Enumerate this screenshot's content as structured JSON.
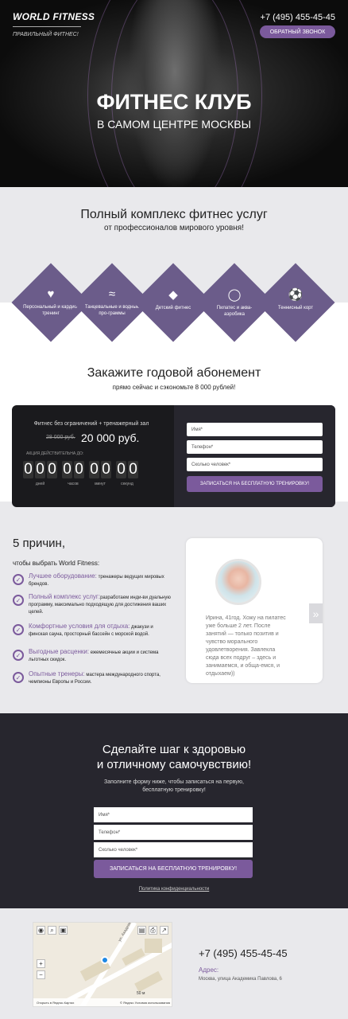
{
  "header": {
    "logo": "WORLD FITNESS",
    "tagline": "ПРАВИЛЬНЫЙ ФИТНЕС!",
    "phone": "+7 (495) 455-45-45",
    "callback_button": "ОБРАТНЫЙ ЗВОНОК",
    "hero_title": "ФИТНЕС КЛУБ",
    "hero_subtitle": "В САМОМ ЦЕНТРЕ МОСКВЫ"
  },
  "services": {
    "title": "Полный комплекс фитнес услуг",
    "subtitle": "от профессионалов мирового уровня!",
    "items": [
      {
        "label": "Персональный и кардио-тренинг",
        "icon": "heart-pulse-icon"
      },
      {
        "label": "Танцевальные и водные про-граммы",
        "icon": "swimmer-icon"
      },
      {
        "label": "Детский фитнес",
        "icon": "kids-icon"
      },
      {
        "label": "Пилатес и аква-аэробика",
        "icon": "pilates-icon"
      },
      {
        "label": "Теннисный корт",
        "icon": "tennis-ball-icon"
      }
    ]
  },
  "offer": {
    "title": "Закажите годовой абонемент",
    "subtitle": "прямо сейчас и сэкономьте 8 000 рублей!",
    "description": "Фитнес без ограничений + тренажерный зал",
    "old_price": "28 000 руб.",
    "new_price": "20 000 руб.",
    "timer_label": "АКЦИЯ ДЕЙСТВИТЕЛЬНА ДО:",
    "timer": [
      {
        "digits": [
          "0",
          "0",
          "0"
        ],
        "unit": "дней"
      },
      {
        "digits": [
          "0",
          "0"
        ],
        "unit": "часов"
      },
      {
        "digits": [
          "0",
          "0"
        ],
        "unit": "минут"
      },
      {
        "digits": [
          "0",
          "0"
        ],
        "unit": "секунд"
      }
    ],
    "form": {
      "name_placeholder": "Имя*",
      "phone_placeholder": "Телефон*",
      "people_placeholder": "Сколько человек*",
      "submit": "ЗАПИСАТЬСЯ НА БЕСПЛАТНУЮ ТРЕНИРОВКУ!"
    }
  },
  "reasons": {
    "title": "5 причин,",
    "subtitle": "чтобы выбрать World Fitness:",
    "items": [
      {
        "head": "Лучшее оборудование:",
        "text": " тренажеры ведущих мировых брендов."
      },
      {
        "head": "Полный комплекс услуг:",
        "text": "разработаем инди-ви дуальную программу, максимально подходящую для достижения ваших целей."
      },
      {
        "head": "Комфортные условия для отдыха:",
        "text": " джакузи и финская сауна, просторный бассейн с морской водой."
      },
      {
        "head": "Выгодные расценки:",
        "text": " ежемесячные акции и система льготных скидок."
      },
      {
        "head": "Опытные тренеры:",
        "text": " мастера международного спорта, чемпионы Европы и России."
      }
    ]
  },
  "review": {
    "text": "Ирина, 41год. Хожу на пилатес уже больше 2 лет. После занятий — только позитив и чувство морального удовлетворения. Завлекла сюда всех подруг – здесь и занимаемся, и обща-емся, и отдыхаем))",
    "prev": "«",
    "next": "»"
  },
  "cta": {
    "title_line1": "Сделайте шаг к здоровью",
    "title_line2": "и отличному самочувствию!",
    "text_line1": "Заполните форму ниже, чтобы записаться на первую,",
    "text_line2": "бесплатную тренировку!",
    "name_placeholder": "Имя*",
    "phone_placeholder": "Телефон*",
    "people_placeholder": "Сколько человек*",
    "submit": "ЗАПИСАТЬСЯ НА БЕСПЛАТНУЮ ТРЕНИРОВКУ!",
    "policy": "Политика конфиденциальности"
  },
  "contacts": {
    "phone": "+7 (495) 455-45-45",
    "address_label": "Адрес:",
    "address": "Москва, улица Академика Павлова, 6",
    "map_open_link": "Открыть в Яндекс.Картах",
    "map_credits": "© Яндекс Условия использования",
    "map_scale": "50 м",
    "map_zoom_in": "+",
    "map_zoom_out": "−",
    "map_street": "ул. Академика"
  },
  "colors": {
    "accent": "#7b5a9c",
    "dark": "#1a1a1d"
  }
}
